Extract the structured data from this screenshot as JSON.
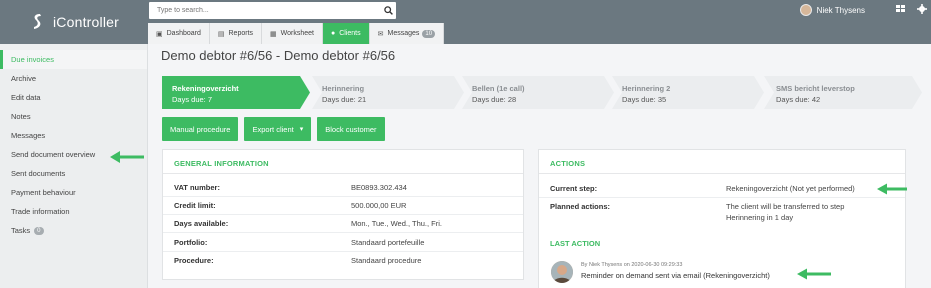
{
  "app": {
    "name": "iController"
  },
  "search": {
    "placeholder": "Type to search..."
  },
  "user": {
    "name": "Niek Thysens"
  },
  "tabs": [
    {
      "label": "Dashboard",
      "icon": "dashboard-icon"
    },
    {
      "label": "Reports",
      "icon": "reports-icon"
    },
    {
      "label": "Worksheet",
      "icon": "worksheet-icon"
    },
    {
      "label": "Clients",
      "icon": "clients-icon",
      "active": true
    },
    {
      "label": "Messages",
      "icon": "messages-icon",
      "badge": "10"
    }
  ],
  "sidebar": {
    "items": [
      {
        "label": "Due invoices",
        "active": true
      },
      {
        "label": "Archive"
      },
      {
        "label": "Edit data"
      },
      {
        "label": "Notes"
      },
      {
        "label": "Messages"
      },
      {
        "label": "Send document overview"
      },
      {
        "label": "Sent documents"
      },
      {
        "label": "Payment behaviour"
      },
      {
        "label": "Trade information"
      },
      {
        "label": "Tasks",
        "count": "0"
      }
    ]
  },
  "page": {
    "title": "Demo debtor #6/56 - Demo debtor #6/56"
  },
  "steps": [
    {
      "name": "Rekeningoverzicht",
      "due": "Days due: 7",
      "active": true
    },
    {
      "name": "Herinnering",
      "due": "Days due: 21"
    },
    {
      "name": "Bellen (1e call)",
      "due": "Days due: 28"
    },
    {
      "name": "Herinnering 2",
      "due": "Days due: 35"
    },
    {
      "name": "SMS bericht leverstop",
      "due": "Days due: 42"
    }
  ],
  "buttons": {
    "manual": "Manual procedure",
    "export": "Export client",
    "block": "Block customer"
  },
  "general": {
    "heading": "GENERAL INFORMATION",
    "rows": [
      {
        "label": "VAT number:",
        "value": "BE0893.302.434"
      },
      {
        "label": "Credit limit:",
        "value": "500.000,00 EUR"
      },
      {
        "label": "Days available:",
        "value": "Mon., Tue., Wed., Thu., Fri."
      },
      {
        "label": "Portfolio:",
        "value": "Standaard portefeuille"
      },
      {
        "label": "Procedure:",
        "value": "Standaard procedure"
      }
    ]
  },
  "actions": {
    "heading": "ACTIONS",
    "current_label": "Current step:",
    "current_value": "Rekeningoverzicht (Not yet performed)",
    "planned_label": "Planned actions:",
    "planned_line1": "The client will be transferred to step",
    "planned_line2": "Herinnering in 1 day"
  },
  "last_action": {
    "heading": "LAST ACTION",
    "meta": "By Niek Thysens on 2020-06-30 09:29:33",
    "text": "Reminder on demand sent via email (Rekeningoverzicht)"
  },
  "colors": {
    "accent": "#3dbb62",
    "header": "#6b7880",
    "sidebar": "#eceeef"
  }
}
